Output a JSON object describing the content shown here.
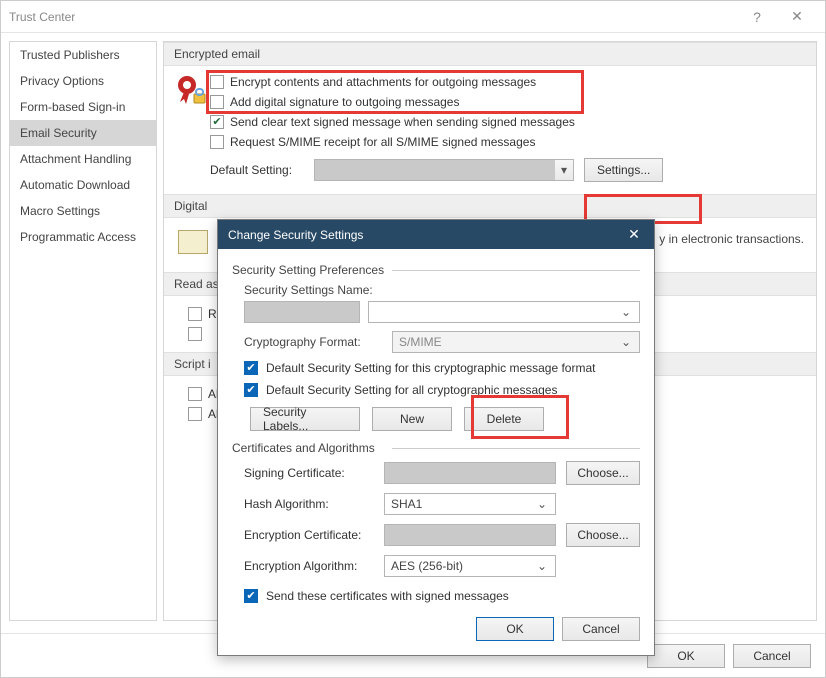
{
  "window": {
    "title": "Trust Center"
  },
  "sidebar": {
    "items": [
      "Trusted Publishers",
      "Privacy Options",
      "Form-based Sign-in",
      "Email Security",
      "Attachment Handling",
      "Automatic Download",
      "Macro Settings",
      "Programmatic Access"
    ],
    "selected_index": 3
  },
  "main": {
    "groups": {
      "encrypted": {
        "title": "Encrypted email",
        "opts": {
          "encrypt": "Encrypt contents and attachments for outgoing messages",
          "sign": "Add digital signature to outgoing messages",
          "cleartext": "Send clear text signed message when sending signed messages",
          "receipt": "Request S/MIME receipt for all S/MIME signed messages"
        },
        "default_label": "Default Setting:",
        "default_value": "",
        "settings_btn": "Settings..."
      },
      "digital": {
        "title": "Digital",
        "blurb_tail": "y in electronic transactions."
      },
      "read": {
        "title": "Read as",
        "opt1": "Re"
      },
      "script": {
        "title": "Script i",
        "opt1": "Al",
        "opt2": "Al"
      }
    }
  },
  "dialog": {
    "title": "Change Security Settings",
    "prefs_label": "Security Setting Preferences",
    "name_label": "Security Settings Name:",
    "name_value": "",
    "crypto_label": "Cryptography Format:",
    "crypto_value": "S/MIME",
    "chk1": "Default Security Setting for this cryptographic message format",
    "chk2": "Default Security Setting for all cryptographic messages",
    "btn_labels": "Security Labels...",
    "btn_new": "New",
    "btn_delete": "Delete",
    "certs_label": "Certificates and Algorithms",
    "sign_cert": "Signing Certificate:",
    "hash": "Hash Algorithm:",
    "hash_value": "SHA1",
    "enc_cert": "Encryption Certificate:",
    "enc_alg": "Encryption Algorithm:",
    "enc_alg_value": "AES (256-bit)",
    "choose": "Choose...",
    "send_certs": "Send these certificates with signed messages",
    "ok": "OK",
    "cancel": "Cancel"
  },
  "footer": {
    "ok": "OK",
    "cancel": "Cancel"
  }
}
